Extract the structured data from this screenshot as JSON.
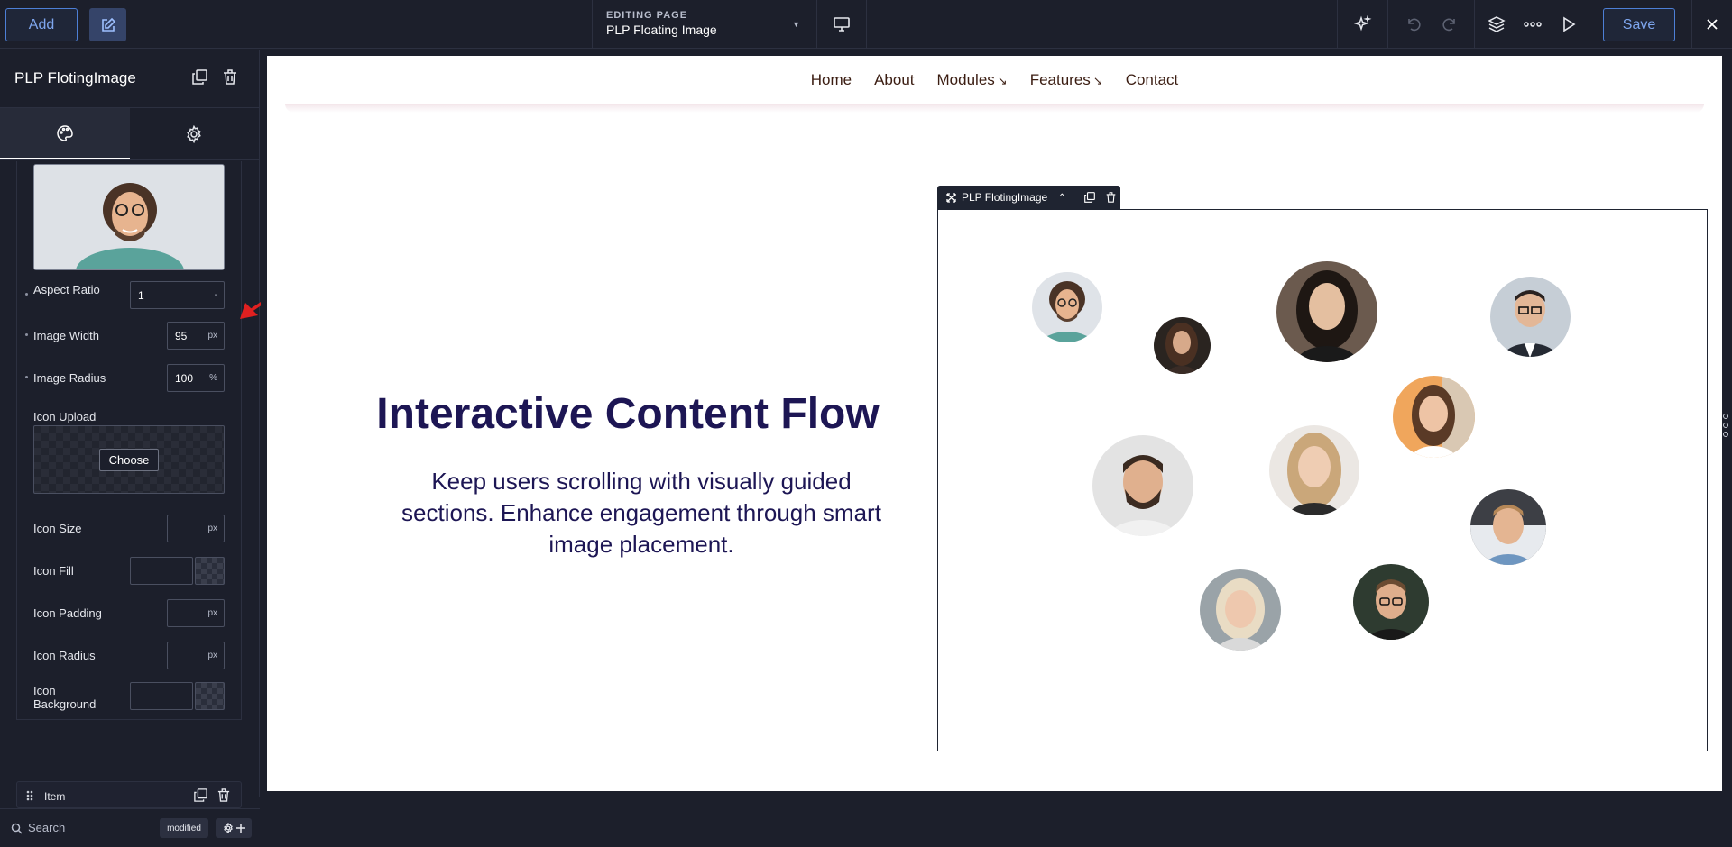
{
  "topbar": {
    "add_label": "Add",
    "editing_caption": "EDITING PAGE",
    "page_name": "PLP Floating Image",
    "save_label": "Save"
  },
  "panel": {
    "title": "PLP FlotingImage",
    "fields": {
      "aspect_ratio_label": "Aspect Ratio",
      "aspect_ratio_value": "1",
      "aspect_ratio_unit": "-",
      "image_width_label": "Image Width",
      "image_width_value": "95",
      "image_width_unit": "px",
      "image_radius_label": "Image Radius",
      "image_radius_value": "100",
      "image_radius_unit": "%",
      "icon_upload_label": "Icon Upload",
      "choose_label": "Choose",
      "icon_size_label": "Icon Size",
      "icon_size_unit": "px",
      "icon_fill_label": "Icon Fill",
      "icon_padding_label": "Icon Padding",
      "icon_padding_unit": "px",
      "icon_radius_label": "Icon Radius",
      "icon_radius_unit": "px",
      "icon_background_label": "Icon Background"
    },
    "item_label": "Item",
    "search_placeholder": "Search",
    "modified_badge": "modified"
  },
  "site": {
    "nav": [
      "Home",
      "About",
      "Modules",
      "Features",
      "Contact"
    ],
    "hero_title": "Interactive Content Flow",
    "hero_text": "Keep users scrolling with visually guided sections. Enhance engagement through smart image placement.",
    "module_tag": "PLP FlotingImage"
  },
  "colors": {
    "accent": "#4d7fd6",
    "hero_text": "#1d1654",
    "nav_text": "#3b1d12",
    "annotation_arrow": "#e02020"
  }
}
